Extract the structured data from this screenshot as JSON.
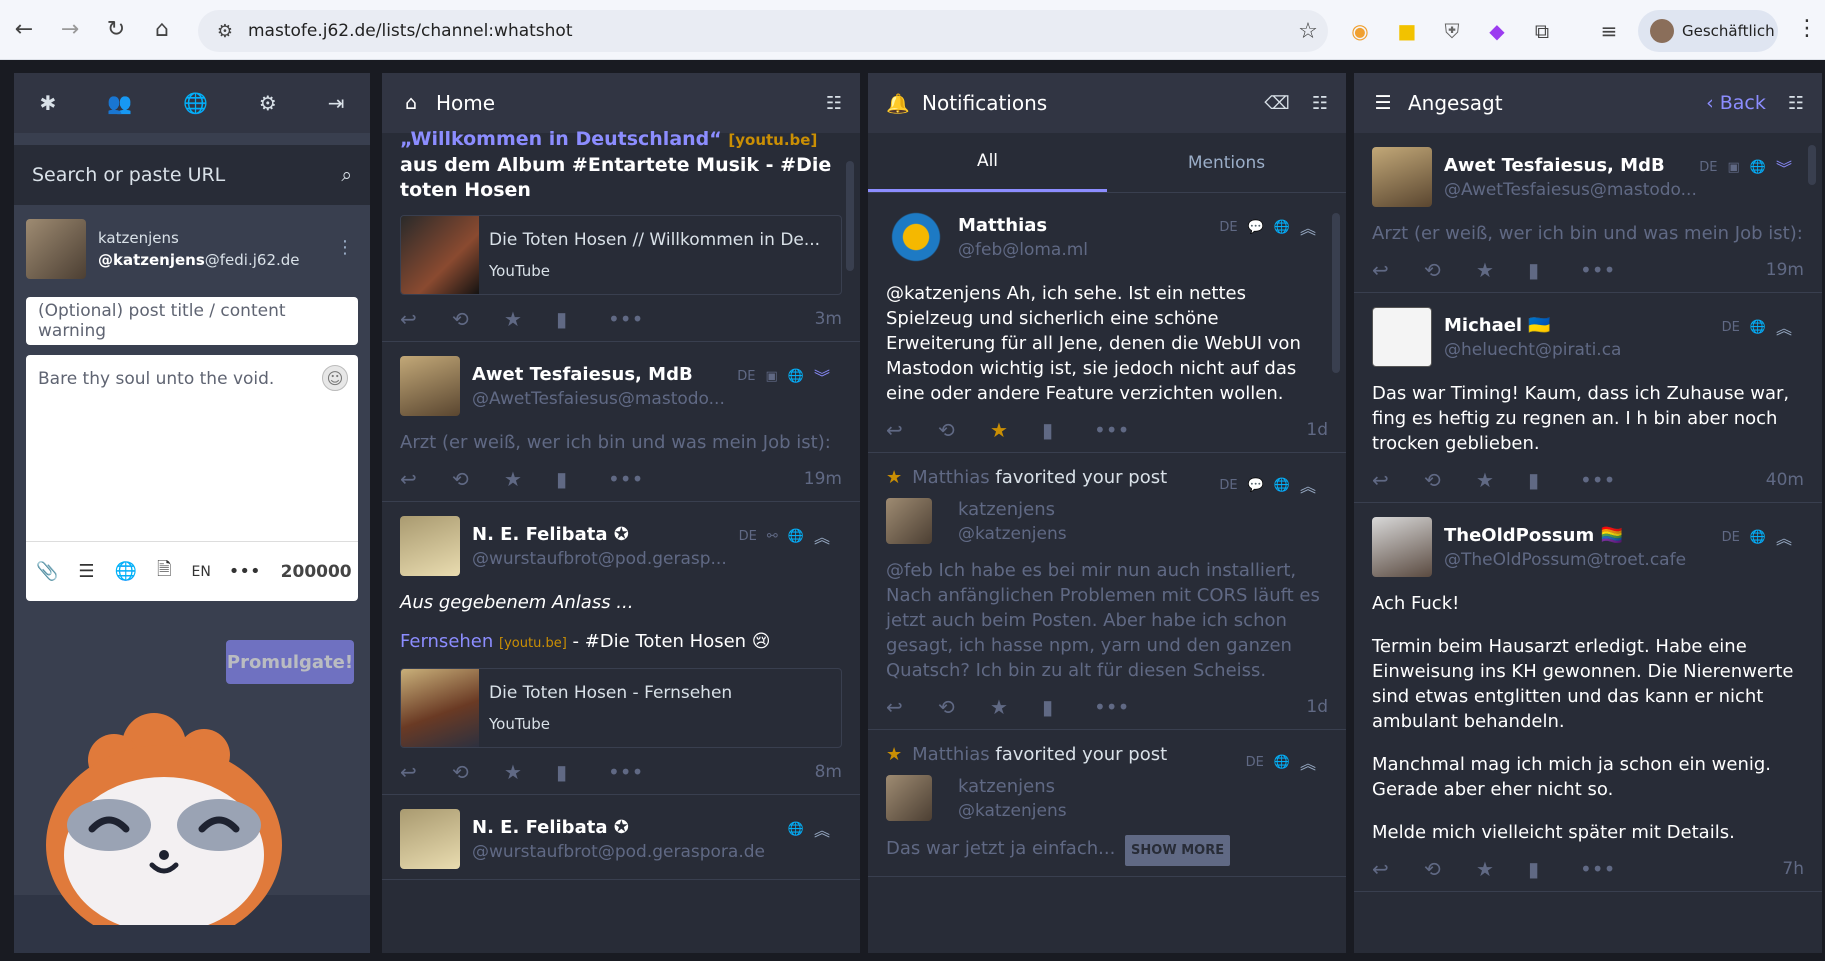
{
  "browser": {
    "url": "mastofe.j62.de/lists/channel:whatshot",
    "profile": "Geschäftlich"
  },
  "compose": {
    "search_placeholder": "Search or paste URL",
    "account_display": "katzenjens",
    "account_user": "@katzenjens",
    "account_domain": "@fedi.j62.de",
    "cw_placeholder": "(Optional) post title / content warning",
    "text_placeholder": "Bare thy soul unto the void.",
    "lang": "EN",
    "char_count": "200000",
    "publish_label": "Promulgate!"
  },
  "home": {
    "title": "Home",
    "top_text_a": "„Willkommen in Deutschland“",
    "top_text_link": "[youtu.be]",
    "top_text_b": "aus dem Album #Entartete Musik - #Die toten Hosen",
    "card1_title": "Die Toten Hosen // Willkommen in De...",
    "card1_provider": "YouTube",
    "time1": "3m",
    "s2_name": "Awet Tesfaiesus, MdB",
    "s2_handle": "@AwetTesfaiesus@mastodo...",
    "s2_lang": "DE",
    "s2_body": "Arzt (er weiß, wer ich bin und was mein Job ist):",
    "s2_time": "19m",
    "s3_name": "N. E. Felibata",
    "s3_handle": "@wurstaufbrot@pod.gerasp...",
    "s3_lang": "DE",
    "s3_body1": "Aus gegebenem Anlass ...",
    "s3_link": "Fernsehen",
    "s3_link2": "[youtu.be]",
    "s3_body2": "- #Die Toten Hosen 😢",
    "card2_title": "Die Toten Hosen - Fernsehen",
    "card2_provider": "YouTube",
    "s3_time": "8m",
    "s4_name": "N. E. Felibata",
    "s4_handle": "@wurstaufbrot@pod.geraspora.de"
  },
  "notifications": {
    "title": "Notifications",
    "tab_all": "All",
    "tab_mentions": "Mentions",
    "n1_name": "Matthias",
    "n1_handle": "@feb@loma.ml",
    "n1_lang": "DE",
    "n1_body": "@katzenjens Ah, ich sehe. Ist ein nettes Spielzeug und sicherlich eine schöne Erweiterung für all Jene, denen die WebUI von Mastodon wichtig ist, sie jedoch nicht auf das eine oder andere Feature verzichten wollen.",
    "n1_time": "1d",
    "n2_actor": "Matthias",
    "n2_text": "favorited your post",
    "n2_lang": "DE",
    "n2_name": "katzenjens",
    "n2_handle": "@katzenjens",
    "n2_body": "@feb Ich habe es bei mir nun auch installiert, Nach anfänglichen Problemen mit CORS läuft es jetzt auch beim Posten. Aber habe ich schon gesagt, ich hasse npm, yarn und den ganzen Quatsch? Ich bin zu alt für diesen Scheiss.",
    "n2_time": "1d",
    "n3_actor": "Matthias",
    "n3_text": "favorited your post",
    "n3_lang": "DE",
    "n3_name": "katzenjens",
    "n3_handle": "@katzenjens",
    "n3_body": "Das war jetzt ja einfach...",
    "n3_more": "SHOW MORE"
  },
  "trending": {
    "title": "Angesagt",
    "back": "Back",
    "t1_name": "Awet Tesfaiesus, MdB",
    "t1_handle": "@AwetTesfaiesus@mastodo...",
    "t1_lang": "DE",
    "t1_body": "Arzt (er weiß, wer ich bin und was mein Job ist):",
    "t1_time": "19m",
    "t2_name": "Michael 🇺🇦",
    "t2_handle": "@heluecht@pirati.ca",
    "t2_lang": "DE",
    "t2_body": "Das war Timing! Kaum, dass ich Zuhause war, fing es heftig zu regnen an. I h bin aber noch trocken geblieben.",
    "t2_time": "40m",
    "t3_name": "TheOldPossum 🏳️‍🌈",
    "t3_handle": "@TheOldPossum@troet.cafe",
    "t3_lang": "DE",
    "t3_p1": "Ach Fuck!",
    "t3_p2": "Termin beim Hausarzt erledigt. Habe eine Einweisung ins KH gewonnen. Die Nierenwerte sind etwas entglitten und das kann er nicht ambulant behandeln.",
    "t3_p3": "Manchmal mag ich mich ja schon ein wenig. Gerade aber eher nicht so.",
    "t3_p4": "Melde mich vielleicht später mit Details.",
    "t3_time": "7h"
  }
}
